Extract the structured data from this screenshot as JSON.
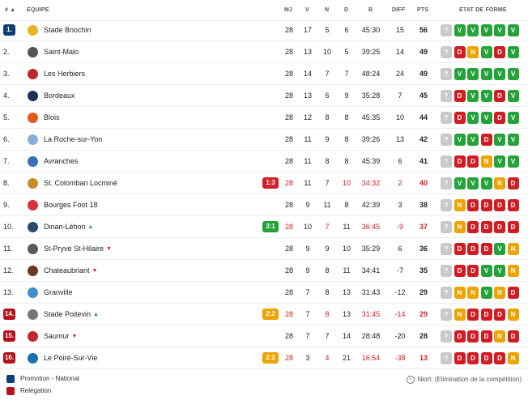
{
  "header": {
    "rank": "# ▲",
    "team": "EQUIPE",
    "mj": "MJ",
    "v": "V",
    "n": "N",
    "d": "D",
    "b": "B",
    "diff": "DIFF",
    "pts": "PTS",
    "form": "ETAT DE FORME"
  },
  "colors": {
    "promotion": "#0d3f77",
    "relegation": "#b5121b",
    "win": "#26a23b",
    "draw": "#eda300",
    "loss": "#cf1d23",
    "live": "#d0202a",
    "live_win": "#26a23b",
    "live_draw": "#eda300"
  },
  "rows": [
    {
      "rank": "1.",
      "zone": "promotion",
      "team": "Stade Briochin",
      "trend": "",
      "live": "",
      "live_type": "",
      "mj": "28",
      "v": "17",
      "n": "5",
      "d": "6",
      "b": "45:30",
      "diff": "15",
      "pts": "56",
      "form": [
        "?",
        "V",
        "V",
        "V",
        "V",
        "V"
      ],
      "logo": "#e8b422",
      "logo_icon": "stade-briochin-logo"
    },
    {
      "rank": "2.",
      "zone": "",
      "team": "Saint-Malo",
      "trend": "",
      "live": "",
      "live_type": "",
      "mj": "28",
      "v": "13",
      "n": "10",
      "d": "5",
      "b": "39:25",
      "diff": "14",
      "pts": "49",
      "form": [
        "?",
        "D",
        "N",
        "V",
        "D",
        "V"
      ],
      "logo": "#555555",
      "logo_icon": "saint-malo-logo"
    },
    {
      "rank": "3.",
      "zone": "",
      "team": "Les Herbiers",
      "trend": "",
      "live": "",
      "live_type": "",
      "mj": "28",
      "v": "14",
      "n": "7",
      "d": "7",
      "b": "48:24",
      "diff": "24",
      "pts": "49",
      "form": [
        "?",
        "V",
        "V",
        "V",
        "V",
        "V"
      ],
      "logo": "#c0262d",
      "logo_icon": "les-herbiers-logo"
    },
    {
      "rank": "4.",
      "zone": "",
      "team": "Bordeaux",
      "trend": "",
      "live": "",
      "live_type": "",
      "mj": "28",
      "v": "13",
      "n": "6",
      "d": "9",
      "b": "35:28",
      "diff": "7",
      "pts": "45",
      "form": [
        "?",
        "D",
        "V",
        "V",
        "D",
        "V"
      ],
      "logo": "#1c2f5e",
      "logo_icon": "bordeaux-logo"
    },
    {
      "rank": "5.",
      "zone": "",
      "team": "Blois",
      "trend": "",
      "live": "",
      "live_type": "",
      "mj": "28",
      "v": "12",
      "n": "8",
      "d": "8",
      "b": "45:35",
      "diff": "10",
      "pts": "44",
      "form": [
        "?",
        "D",
        "V",
        "V",
        "D",
        "V"
      ],
      "logo": "#e35a1b",
      "logo_icon": "blois-logo"
    },
    {
      "rank": "6.",
      "zone": "",
      "team": "La Roche-sur-Yon",
      "trend": "",
      "live": "",
      "live_type": "",
      "mj": "28",
      "v": "11",
      "n": "9",
      "d": "8",
      "b": "39:26",
      "diff": "13",
      "pts": "42",
      "form": [
        "?",
        "V",
        "V",
        "D",
        "V",
        "V"
      ],
      "logo": "#8aaed8",
      "logo_icon": "la-roche-sur-yon-logo"
    },
    {
      "rank": "7.",
      "zone": "",
      "team": "Avranches",
      "trend": "",
      "live": "",
      "live_type": "",
      "mj": "28",
      "v": "11",
      "n": "8",
      "d": "8",
      "b": "45:39",
      "diff": "6",
      "pts": "41",
      "form": [
        "?",
        "D",
        "D",
        "N",
        "V",
        "V"
      ],
      "logo": "#3a6fb8",
      "logo_icon": "avranches-logo"
    },
    {
      "rank": "8.",
      "zone": "",
      "team": "St. Colomban Locminé",
      "trend": "",
      "live": "1:3",
      "live_type": "loss",
      "mj": "28",
      "v": "11",
      "n": "7",
      "d": "10",
      "b": "34:32",
      "diff": "2",
      "pts": "40",
      "form": [
        "?",
        "V",
        "V",
        "V",
        "N",
        "D"
      ],
      "logo": "#c98a2a",
      "logo_icon": "st-colomban-locmine-logo"
    },
    {
      "rank": "9.",
      "zone": "",
      "team": "Bourges Foot 18",
      "trend": "",
      "live": "",
      "live_type": "",
      "mj": "28",
      "v": "9",
      "n": "11",
      "d": "8",
      "b": "42:39",
      "diff": "3",
      "pts": "38",
      "form": [
        "?",
        "N",
        "D",
        "D",
        "D",
        "D"
      ],
      "logo": "#d8323a",
      "logo_icon": "bourges-foot-18-logo"
    },
    {
      "rank": "10.",
      "zone": "",
      "team": "Dinan-Léhon",
      "trend": "up",
      "live": "3:1",
      "live_type": "win",
      "mj": "28",
      "v": "10",
      "n": "7",
      "d": "11",
      "b": "36:45",
      "diff": "-9",
      "pts": "37",
      "form": [
        "?",
        "N",
        "D",
        "D",
        "D",
        "D"
      ],
      "logo": "#2c4a6b",
      "logo_icon": "dinan-lehon-logo"
    },
    {
      "rank": "11.",
      "zone": "",
      "team": "St-Pryvé St-Hilaire",
      "trend": "down",
      "live": "",
      "live_type": "",
      "mj": "28",
      "v": "9",
      "n": "9",
      "d": "10",
      "b": "35:29",
      "diff": "6",
      "pts": "36",
      "form": [
        "?",
        "D",
        "D",
        "D",
        "V",
        "N"
      ],
      "logo": "#5a5a5a",
      "logo_icon": "st-pryve-st-hilaire-logo"
    },
    {
      "rank": "12.",
      "zone": "",
      "team": "Chateaubriant",
      "trend": "down",
      "live": "",
      "live_type": "",
      "mj": "28",
      "v": "9",
      "n": "8",
      "d": "11",
      "b": "34:41",
      "diff": "-7",
      "pts": "35",
      "form": [
        "?",
        "D",
        "D",
        "V",
        "V",
        "N"
      ],
      "logo": "#6b3a1e",
      "logo_icon": "chateaubriant-logo"
    },
    {
      "rank": "13.",
      "zone": "",
      "team": "Granville",
      "trend": "",
      "live": "",
      "live_type": "",
      "mj": "28",
      "v": "7",
      "n": "8",
      "d": "13",
      "b": "31:43",
      "diff": "-12",
      "pts": "29",
      "form": [
        "?",
        "N",
        "N",
        "V",
        "N",
        "D"
      ],
      "logo": "#3d8fd1",
      "logo_icon": "granville-logo"
    },
    {
      "rank": "14.",
      "zone": "relegation",
      "team": "Stade Poitevin",
      "trend": "up",
      "live": "2:2",
      "live_type": "draw",
      "mj": "28",
      "v": "7",
      "n": "8",
      "d": "13",
      "b": "31:45",
      "diff": "-14",
      "pts": "29",
      "form": [
        "?",
        "N",
        "D",
        "D",
        "D",
        "N"
      ],
      "logo": "#777777",
      "logo_icon": "stade-poitevin-logo"
    },
    {
      "rank": "15.",
      "zone": "relegation",
      "team": "Saumur",
      "trend": "down",
      "live": "",
      "live_type": "",
      "mj": "28",
      "v": "7",
      "n": "7",
      "d": "14",
      "b": "28:48",
      "diff": "-20",
      "pts": "28",
      "form": [
        "?",
        "D",
        "D",
        "D",
        "N",
        "D"
      ],
      "logo": "#c0262d",
      "logo_icon": "saumur-logo"
    },
    {
      "rank": "16.",
      "zone": "relegation",
      "team": "Le Poiré-Sur-Vie",
      "trend": "",
      "live": "2:2",
      "live_type": "draw",
      "mj": "28",
      "v": "3",
      "n": "4",
      "d": "21",
      "b": "16:54",
      "diff": "-38",
      "pts": "13",
      "form": [
        "?",
        "D",
        "D",
        "D",
        "D",
        "N"
      ],
      "logo": "#1c6fb3",
      "logo_icon": "le-poire-sur-vie-logo"
    }
  ],
  "legend": {
    "promotion": "Promotion - National",
    "relegation": "Relégation"
  },
  "note": "Niort: (Elimination de la compétition)"
}
